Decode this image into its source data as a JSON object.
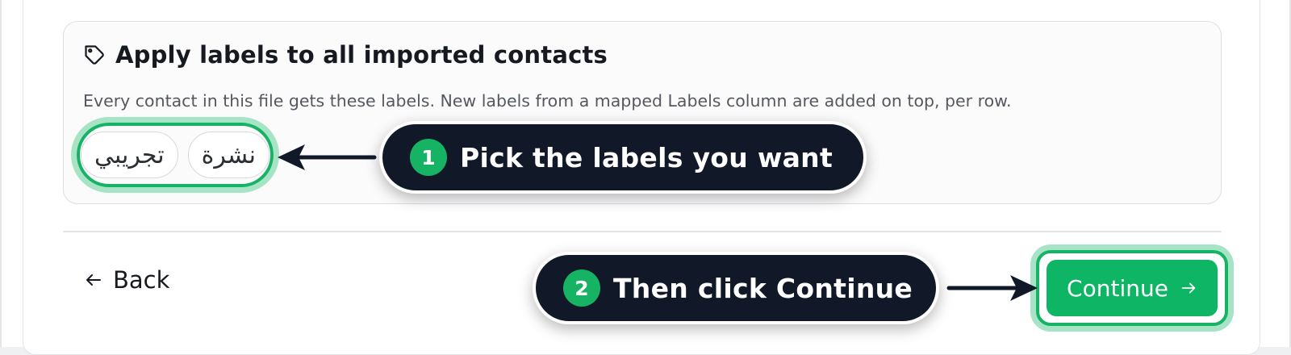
{
  "labels_card": {
    "title": "Apply labels to all imported contacts",
    "description": "Every contact in this file gets these labels. New labels from a mapped Labels column are added on top, per row.",
    "chips": [
      "تجريبي",
      "نشرة"
    ]
  },
  "footer": {
    "back_label": "Back",
    "continue_label": "Continue"
  },
  "callouts": [
    {
      "step": "1",
      "text": "Pick the labels you want"
    },
    {
      "step": "2",
      "text": "Then click Continue"
    }
  ],
  "colors": {
    "accent": "#16b364",
    "accent_glow": "#a6e4c5",
    "button": "#0db565",
    "callout_bg": "#111827"
  },
  "icons": {
    "tag": "tag-icon",
    "back": "arrow-left-icon",
    "continue": "arrow-right-icon"
  }
}
